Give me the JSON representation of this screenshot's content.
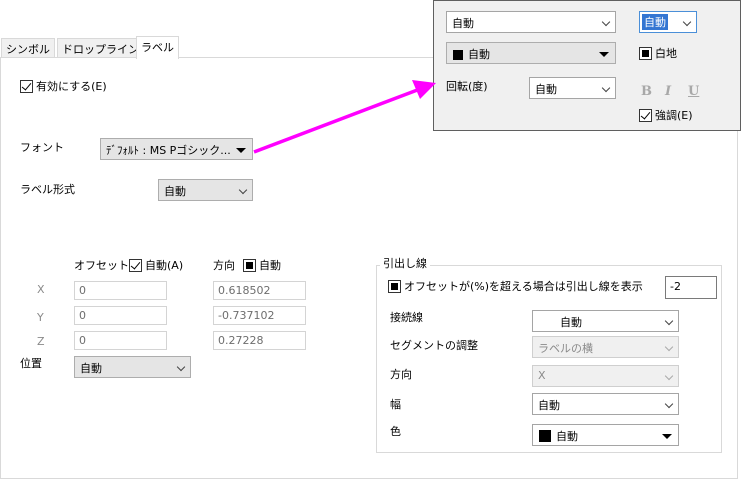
{
  "tabs": [
    {
      "label": "シンボル"
    },
    {
      "label": "ドロップライン"
    },
    {
      "label": "ラベル"
    }
  ],
  "enable": {
    "label": "有効にする(E)",
    "checked": true
  },
  "font": {
    "label": "フォント",
    "value": "ﾃﾞﾌｫﾙﾄ : MS Pゴシック..."
  },
  "label_format": {
    "label": "ラベル形式",
    "value": "自動"
  },
  "offset": {
    "header": "オフセット",
    "auto_label": "自動(A)",
    "direction_header": "方向",
    "direction_auto_label": "自動",
    "x_label": "X",
    "y_label": "Y",
    "z_label": "Z",
    "x_value": "0",
    "y_value": "0",
    "z_value": "0",
    "dir_x": "0.618502",
    "dir_y": "-0.737102",
    "dir_z": "0.27228"
  },
  "position": {
    "label": "位置",
    "value": "自動"
  },
  "leader": {
    "title": "引出し線",
    "show_label": "オフセットが(%)を超える場合は引出し線を表示",
    "threshold": "-2",
    "connector_label": "接続線",
    "connector_value": "自動",
    "segment_label": "セグメントの調整",
    "segment_value": "ラベルの横",
    "direction_label": "方向",
    "direction_value": "X",
    "width_label": "幅",
    "width_value": "自動",
    "color_label": "色",
    "color_value": "自動"
  },
  "popup": {
    "size_value": "自動",
    "size2_value": "自動",
    "color_value": "自動",
    "white_bg_label": "白地",
    "rotation_label": "回転(度)",
    "rotation_value": "自動",
    "bold": "B",
    "italic": "I",
    "underline": "U",
    "emphasis_label": "強調(E)"
  },
  "colors": {
    "arrow": "#ff00ff",
    "swatch": "#000000"
  }
}
